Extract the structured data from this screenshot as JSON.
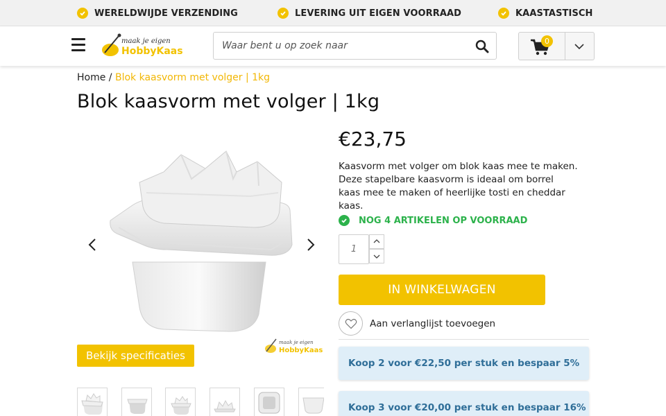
{
  "usp": [
    {
      "label": "WERELDWIJDE VERZENDING"
    },
    {
      "label": "LEVERING UIT EIGEN VOORRAAD"
    },
    {
      "label": "KAASTASTISCH"
    }
  ],
  "header": {
    "logo_text_top": "maak je eigen",
    "logo_text_bottom": "HobbyKaas",
    "search_placeholder": "Waar bent u op zoek naar",
    "cart_count": "0"
  },
  "breadcrumb": {
    "home": "Home",
    "separator": "/",
    "current": "Blok kaasvorm met volger | 1kg"
  },
  "product": {
    "title": "Blok kaasvorm met volger | 1kg",
    "price": "€23,75",
    "description": "Kaasvorm met volger om blok kaas mee te maken. Deze stapelbare kaasvorm is ideaal om borrel kaas mee te maken of heerlijke tosti en cheddar kaas.",
    "stock": "NOG 4 ARTIKELEN OP VOORRAAD",
    "quantity_placeholder": "1",
    "add_to_cart": "IN WINKELWAGEN",
    "wishlist": "Aan verlanglijst toevoegen",
    "spec_button": "Bekijk specificaties",
    "watermark_top": "maak je eigen",
    "watermark_bottom": "HobbyKaas",
    "offers": [
      "Koop 2 voor €22,50 per stuk en bespaar 5%",
      "Koop 3 voor €20,00 per stuk en bespaar 16%"
    ]
  },
  "colors": {
    "accent": "#f2c200",
    "stock_green": "#2cb24b",
    "offer_bg": "#dfeef8",
    "offer_text": "#2f6e98"
  }
}
